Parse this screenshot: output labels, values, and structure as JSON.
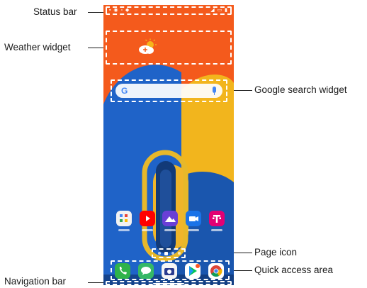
{
  "labels": {
    "status_bar": "Status bar",
    "weather_widget": "Weather widget",
    "google_search_widget": "Google search widget",
    "page_icon": "Page icon",
    "quick_access_area": "Quick access area",
    "navigation_bar": "Navigation bar"
  },
  "search_widget": {
    "logo": "G"
  },
  "apps": [
    {
      "name": "folder",
      "color": "#f2f2f2"
    },
    {
      "name": "youtube",
      "color": "#ff0000"
    },
    {
      "name": "gallery",
      "color": "#6a3fd6"
    },
    {
      "name": "video-call",
      "color": "#1a73e8"
    },
    {
      "name": "t-mobile",
      "color": "#e20074",
      "glyph": "T"
    }
  ],
  "dock_apps": [
    {
      "name": "phone",
      "color": "#2fb34a"
    },
    {
      "name": "messages",
      "color": "#35b865"
    },
    {
      "name": "camera",
      "color": "#f5f5f5"
    },
    {
      "name": "play-store",
      "color": "#ffffff"
    },
    {
      "name": "chrome",
      "color": "#ffffff"
    }
  ],
  "colors": {
    "wallpaper_orange": "#f45a1c",
    "wallpaper_blue": "#1f63c8",
    "wallpaper_yellow": "#f2b51d"
  }
}
